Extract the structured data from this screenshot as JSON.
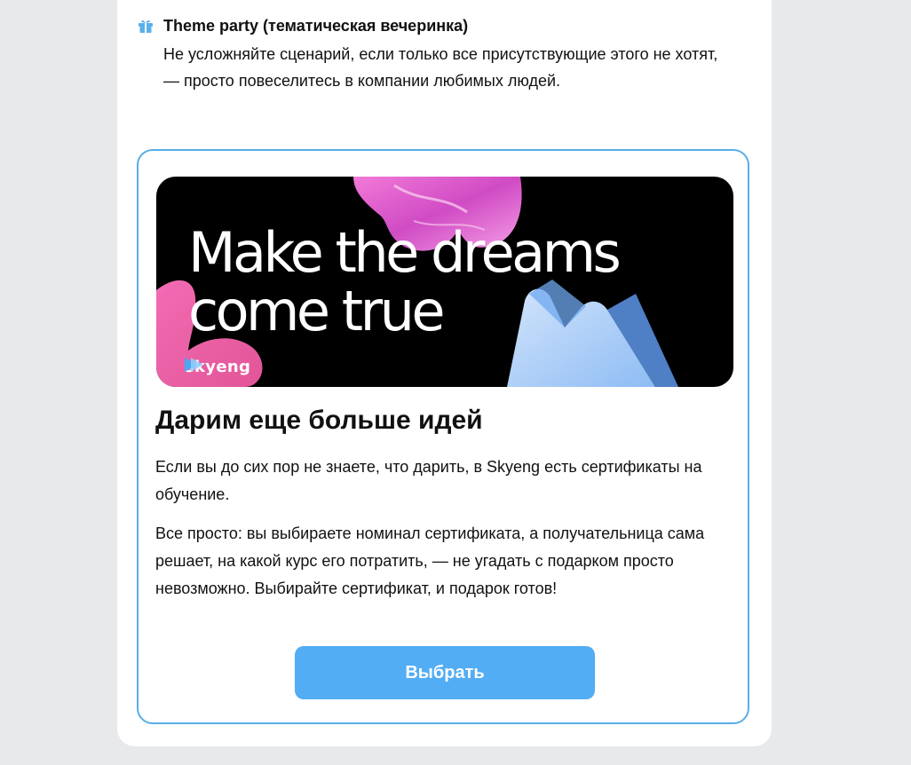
{
  "list_item": {
    "icon": "gift-icon",
    "title": "Theme party (тематическая вечеринка)",
    "text": "Не усложняйте сценарий, если только все присутствующие этого не хотят, — просто повеселитесь в компании любимых людей."
  },
  "promo": {
    "banner": {
      "line1": "Make the dreams",
      "line2": "come true",
      "brand": "skyeng",
      "brand_icon": "play-arrow-icon"
    },
    "heading": "Дарим еще больше идей",
    "paragraph1": "Если вы до сих пор не знаете, что дарить, в Skyeng есть сертификаты на обучение.",
    "paragraph2": "Все просто: вы выбираете номинал сертификата, а получательница сама решает, на какой курс его потратить, — не угадать с подарком просто невозможно. Выбирайте сертификат, и подарок готов!",
    "button_label": "Выбрать"
  },
  "colors": {
    "page_background": "#e8e9eb",
    "card_background": "#ffffff",
    "accent_border": "#5aaee6",
    "button": "#52adf4",
    "icon": "#5ab0ea"
  }
}
